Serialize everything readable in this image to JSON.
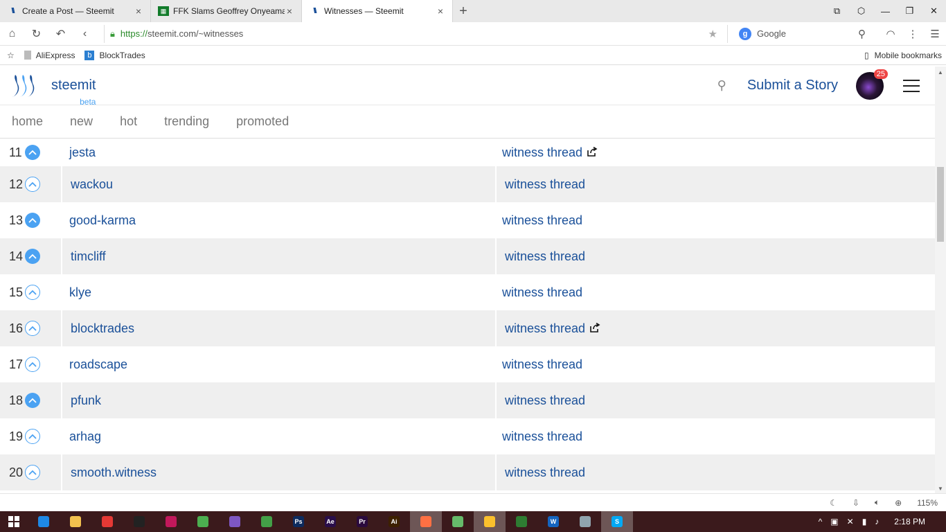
{
  "browser": {
    "tabs": [
      {
        "title": "Create a Post — Steemit",
        "icon": "steemit-favicon",
        "active": false
      },
      {
        "title": "FFK Slams Geoffrey Onyeama",
        "icon": "news-favicon",
        "active": false
      },
      {
        "title": "Witnesses — Steemit",
        "icon": "steemit-favicon",
        "active": true
      }
    ],
    "url_protocol": "https://",
    "url_rest": "steemit.com/~witnesses",
    "search_engine": "Google",
    "bookmarks": [
      "AliExpress",
      "BlockTrades"
    ],
    "mobile_bookmarks": "Mobile bookmarks",
    "zoom": "115%"
  },
  "site": {
    "brand": "steemit",
    "beta": "beta",
    "submit_label": "Submit a Story",
    "notification_count": "25",
    "nav": [
      "home",
      "new",
      "hot",
      "trending",
      "promoted"
    ],
    "accent_color": "#1a5099",
    "vote_color": "#4ba2f2"
  },
  "witnesses": [
    {
      "rank": "11",
      "name": "jesta",
      "thread": "witness thread",
      "voted": true,
      "external": true
    },
    {
      "rank": "12",
      "name": "wackou",
      "thread": "witness thread",
      "voted": false,
      "external": false
    },
    {
      "rank": "13",
      "name": "good-karma",
      "thread": "witness thread",
      "voted": true,
      "external": false
    },
    {
      "rank": "14",
      "name": "timcliff",
      "thread": "witness thread",
      "voted": true,
      "external": false
    },
    {
      "rank": "15",
      "name": "klye",
      "thread": "witness thread",
      "voted": false,
      "external": false
    },
    {
      "rank": "16",
      "name": "blocktrades",
      "thread": "witness thread",
      "voted": false,
      "external": true
    },
    {
      "rank": "17",
      "name": "roadscape",
      "thread": "witness thread",
      "voted": false,
      "external": false
    },
    {
      "rank": "18",
      "name": "pfunk",
      "thread": "witness thread",
      "voted": true,
      "external": false
    },
    {
      "rank": "19",
      "name": "arhag",
      "thread": "witness thread",
      "voted": false,
      "external": false
    },
    {
      "rank": "20",
      "name": "smooth.witness",
      "thread": "witness thread",
      "voted": false,
      "external": false
    }
  ],
  "taskbar": {
    "clock": "2:18 PM",
    "apps": [
      "edge",
      "file-explorer",
      "target-app",
      "media-app",
      "itunes",
      "chrome",
      "image-viewer",
      "utorrent",
      "photoshop",
      "after-effects",
      "premiere",
      "illustrator",
      "uc-browser",
      "globe-app",
      "uc-app",
      "green-app",
      "word",
      "notepad",
      "skype"
    ]
  }
}
